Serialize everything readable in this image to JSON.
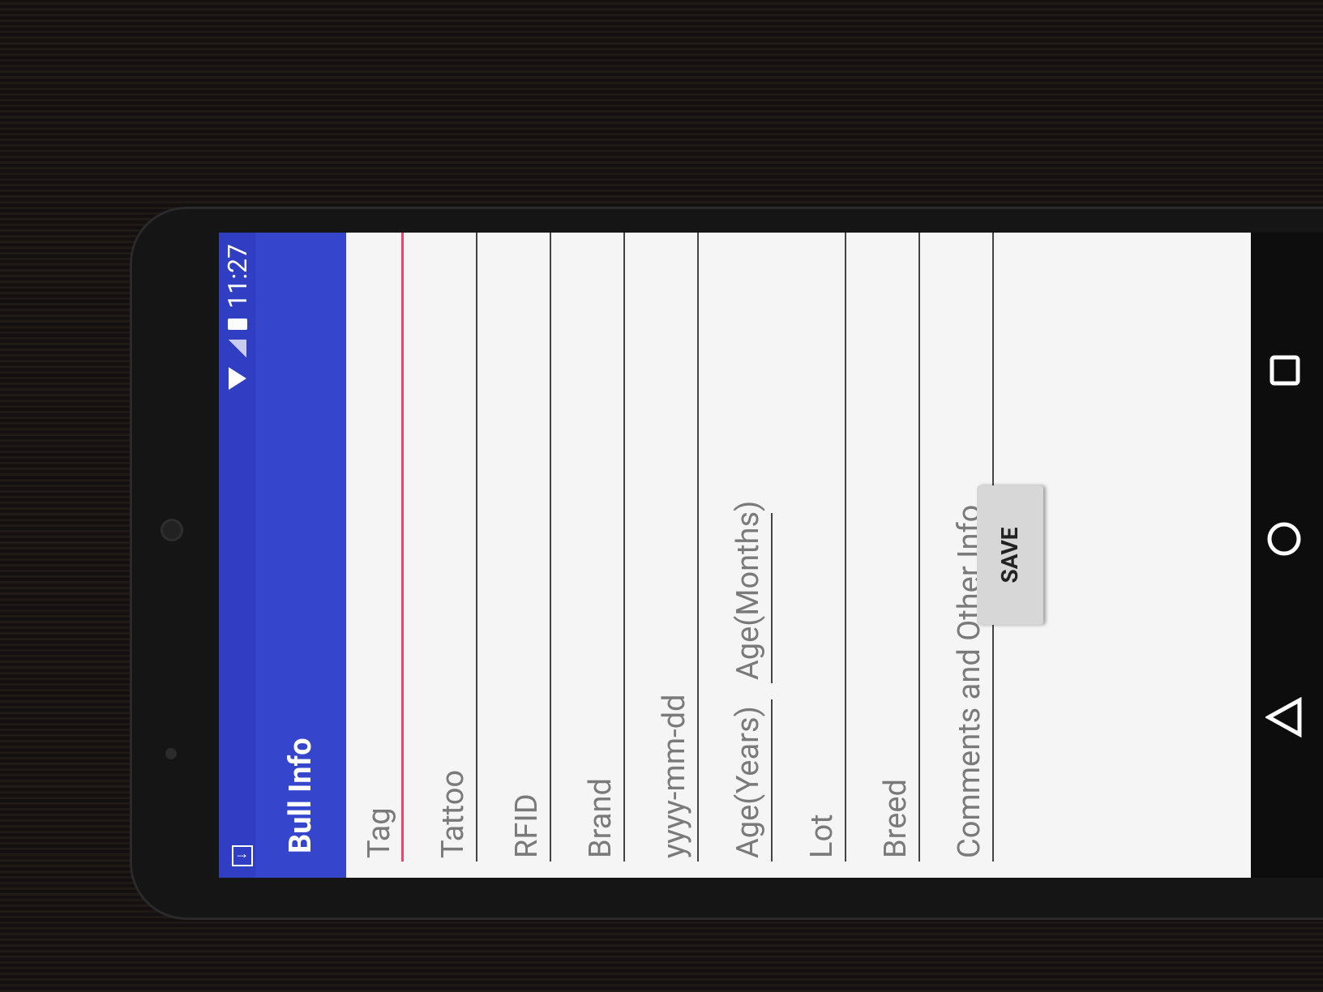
{
  "status_bar": {
    "time": "11:27",
    "download_icon": "download-icon",
    "icons": [
      "wifi-icon",
      "signal-icon",
      "battery-icon"
    ]
  },
  "app_bar": {
    "title": "Bull Info",
    "color": "#3546cc"
  },
  "form": {
    "tag": {
      "placeholder": "Tag",
      "focused": true
    },
    "tattoo": {
      "placeholder": "Tattoo"
    },
    "rfid": {
      "placeholder": "RFID"
    },
    "brand": {
      "placeholder": "Brand"
    },
    "date": {
      "placeholder": "yyyy-mm-dd"
    },
    "age_years": {
      "placeholder": "Age(Years)"
    },
    "age_months": {
      "placeholder": "Age(Months)"
    },
    "lot": {
      "placeholder": "Lot"
    },
    "breed": {
      "placeholder": "Breed"
    },
    "comments": {
      "placeholder": "Comments and Other Info"
    }
  },
  "actions": {
    "save_label": "SAVE"
  },
  "nav": {
    "icons": [
      "back-icon",
      "home-icon",
      "recent-apps-icon"
    ]
  },
  "accent_color": "#f2446a"
}
